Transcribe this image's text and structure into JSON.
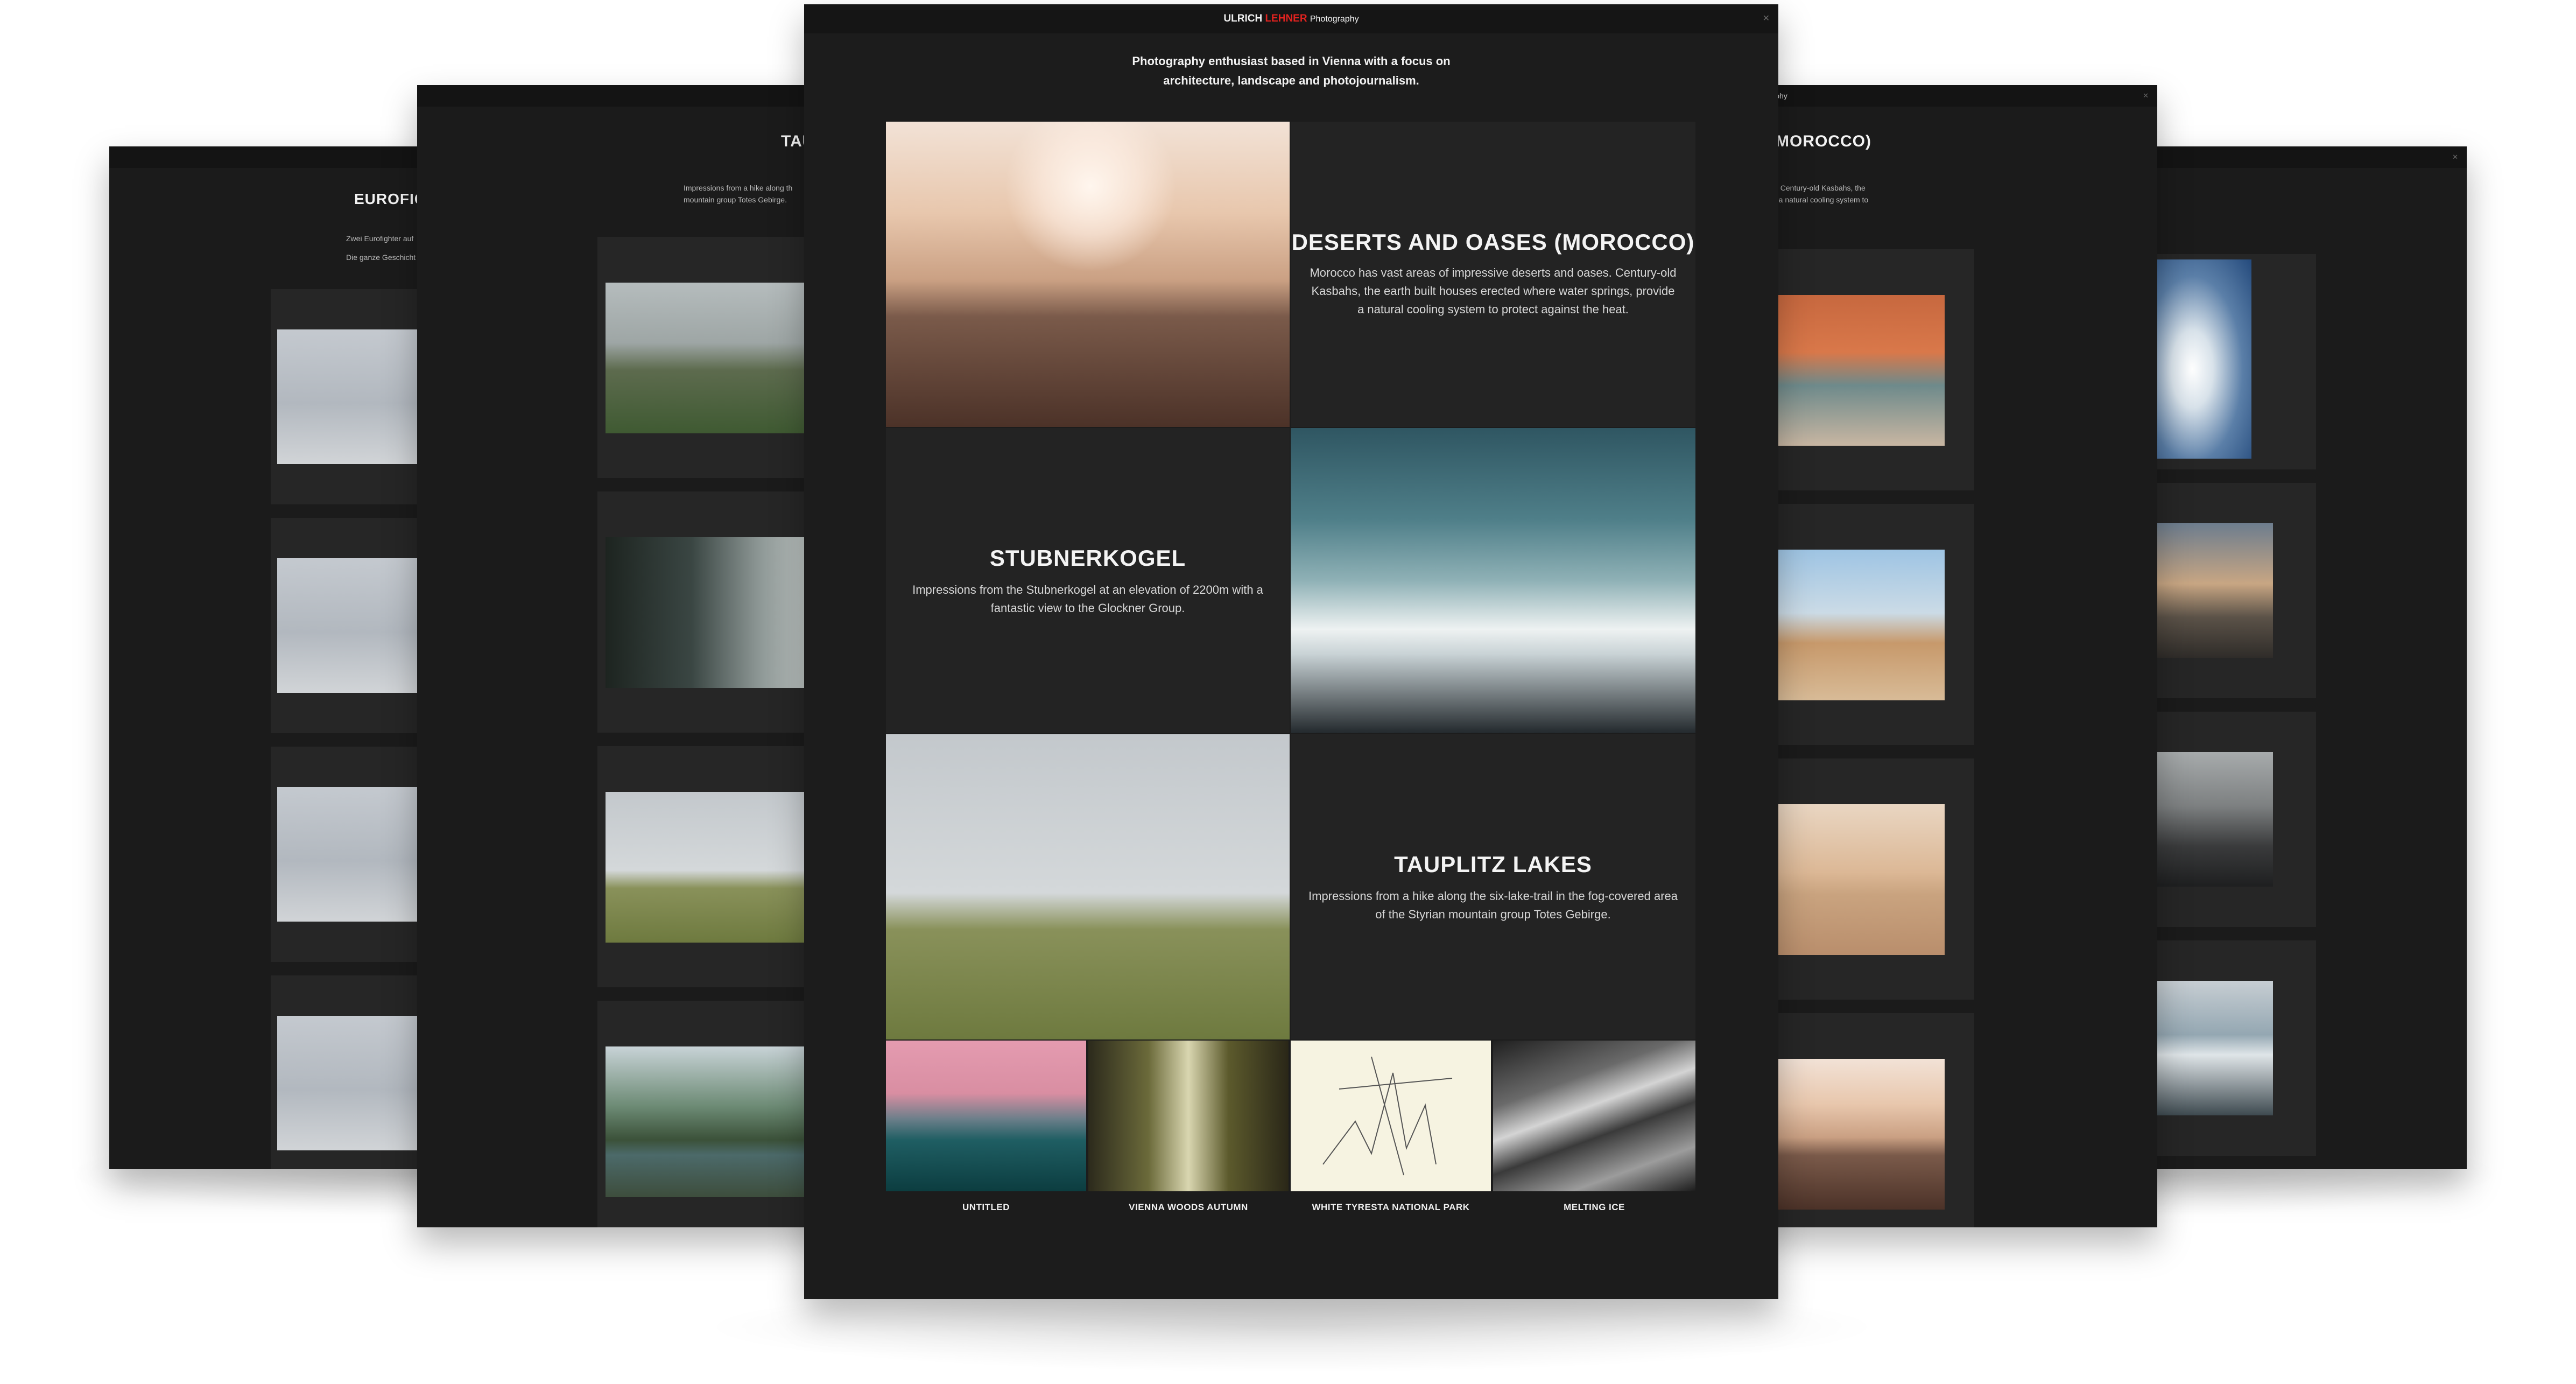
{
  "main": {
    "brand_first": "ULRICH",
    "brand_last": "LEHNER",
    "brand_suffix": "Photography",
    "close_glyph": "✕",
    "intro_line1": "Photography enthusiast based in Vienna with a focus on",
    "intro_line2": "architecture, landscape and photojournalism.",
    "galleries": [
      {
        "title": "DESERTS AND OASES (MOROCCO)",
        "description": "Morocco has vast areas of impressive deserts and oases. Century-old Kasbahs, the earth built houses erected where water springs, provide a natural cooling system to protect against the heat."
      },
      {
        "title": "STUBNERKOGEL",
        "description": "Impressions from the Stubnerkogel at an elevation of 2200m with a fantastic view to the Glockner Group."
      },
      {
        "title": "TAUPLITZ LAKES",
        "description": "Impressions from a hike along the six-lake-trail in the fog-covered area of the Styrian mountain group Totes Gebirge."
      }
    ],
    "thumbnails": [
      {
        "caption": "UNTITLED"
      },
      {
        "caption": "VIENNA WOODS AUTUMN"
      },
      {
        "caption": "WHITE TYRESTA NATIONAL PARK"
      },
      {
        "caption": "MELTING ICE"
      }
    ]
  },
  "left_panel": {
    "title": "TAU",
    "intro_line1": "Impressions from a hike along th",
    "intro_line2": "mountain group Totes Gebirge."
  },
  "far_left_panel": {
    "title": "EUROFIG",
    "intro_line1": "Zwei Eurofighter auf",
    "intro_line2": "Die ganze Geschicht"
  },
  "right_panel": {
    "topbar_text": "graphy",
    "title": "(MOROCCO)",
    "intro_line1": "s. Century-old Kasbahs, the",
    "intro_line2": "e a natural cooling system to"
  }
}
